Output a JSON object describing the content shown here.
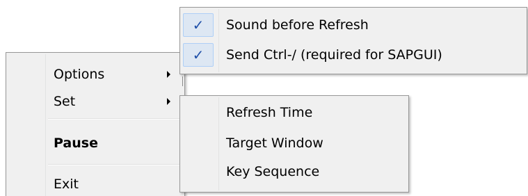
{
  "main_menu": {
    "items": [
      {
        "label": "Options",
        "has_submenu": true
      },
      {
        "label": "Set",
        "has_submenu": true
      },
      {
        "label": "Pause",
        "bold": true
      },
      {
        "label": "Exit"
      }
    ]
  },
  "options_submenu": {
    "items": [
      {
        "label": "Sound before Refresh",
        "checked": true
      },
      {
        "label": "Send Ctrl-/ (required for SAPGUI)",
        "checked": true
      }
    ]
  },
  "set_submenu": {
    "items": [
      {
        "label": "Refresh Time"
      },
      {
        "label": "Target Window"
      },
      {
        "label": "Key Sequence"
      }
    ]
  },
  "icons": {
    "check": "✓",
    "submenu_arrow": "chevron-right-icon"
  },
  "colors": {
    "menu_background": "#f0f0f0",
    "menu_border": "#979797",
    "check_highlight": "#dde7f3",
    "check_color": "#1f4fa8"
  }
}
